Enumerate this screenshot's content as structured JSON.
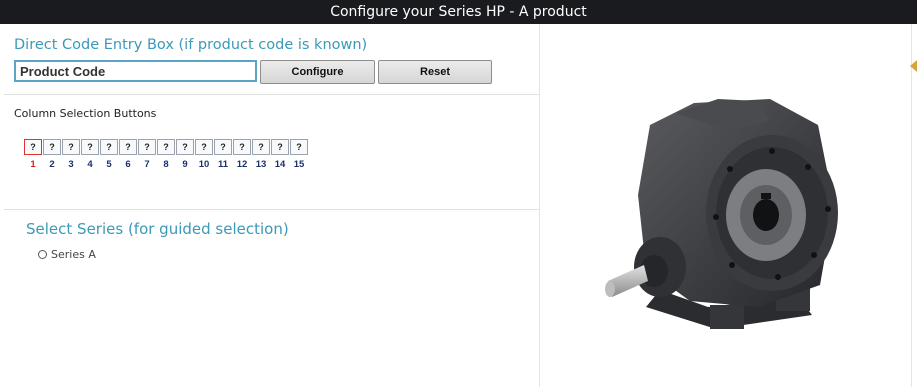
{
  "window": {
    "title": "Configure your Series HP - A product"
  },
  "direct_entry": {
    "heading": "Direct Code Entry Box (if product code is known)",
    "input_placeholder": "Product Code",
    "input_value": "",
    "configure_label": "Configure",
    "reset_label": "Reset"
  },
  "columns": {
    "heading": "Column Selection Buttons",
    "buttons": [
      "?",
      "?",
      "?",
      "?",
      "?",
      "?",
      "?",
      "?",
      "?",
      "?",
      "?",
      "?",
      "?",
      "?",
      "?"
    ],
    "numbers": [
      "1",
      "2",
      "3",
      "4",
      "5",
      "6",
      "7",
      "8",
      "9",
      "10",
      "11",
      "12",
      "13",
      "14",
      "15"
    ],
    "active_index": 0
  },
  "series": {
    "heading": "Select Series (for guided selection)",
    "options": [
      "Series A"
    ]
  },
  "image": {
    "icon": "gearbox-product-image"
  },
  "colors": {
    "accent": "#3a9ab7",
    "title_bg": "#1a1b1f",
    "active_column": "#d22",
    "column_number": "#1b2f6e",
    "side_marker": "#d9a53b"
  }
}
